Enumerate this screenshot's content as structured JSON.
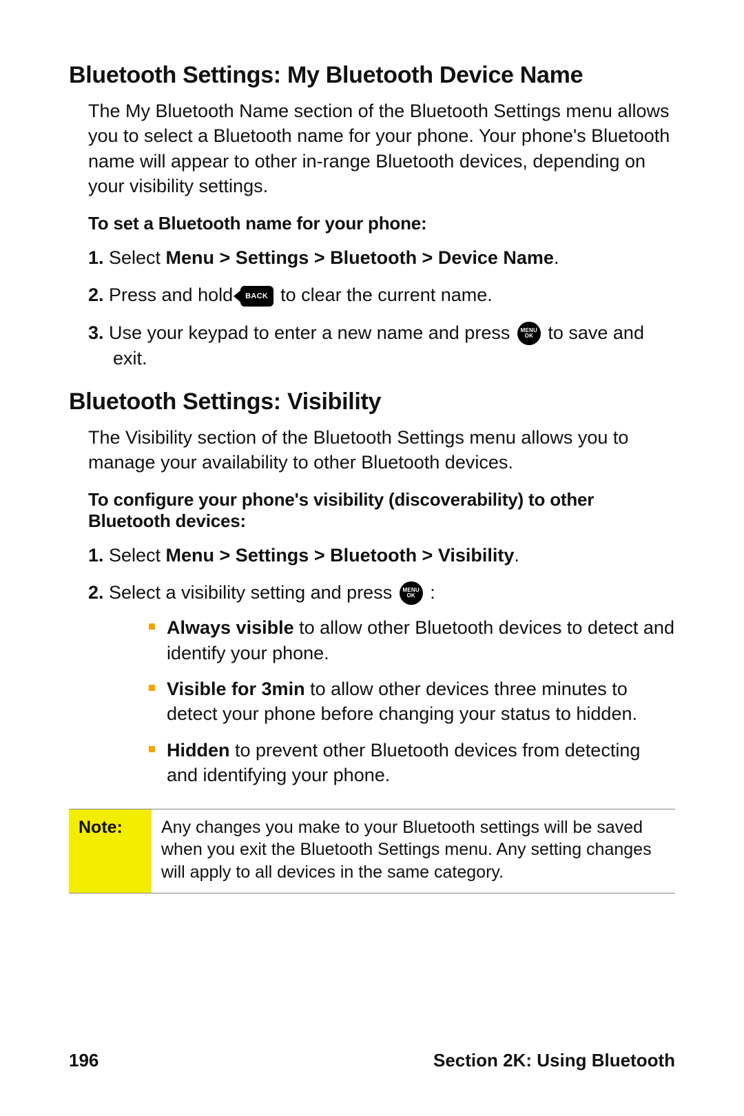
{
  "section1": {
    "heading": "Bluetooth Settings: My Bluetooth Device Name",
    "intro": "The My Bluetooth Name section of the Bluetooth Settings menu allows you to select a Bluetooth name for your phone. Your phone's Bluetooth name will appear to other in-range Bluetooth devices, depending on your visibility settings.",
    "lead": "To set a Bluetooth name for your phone:",
    "steps": {
      "s1": {
        "num": "1.",
        "pre": "Select ",
        "bold": "Menu > Settings > Bluetooth > Device Name",
        "post": "."
      },
      "s2": {
        "num": "2.",
        "pre": "Press and hold ",
        "post": " to clear the current name."
      },
      "s3": {
        "num": "3.",
        "pre": "Use your keypad to enter a new name and press ",
        "post": " to save and exit."
      }
    }
  },
  "section2": {
    "heading": "Bluetooth Settings: Visibility",
    "intro": "The Visibility section of the Bluetooth Settings menu allows you to manage your availability to other Bluetooth devices.",
    "lead": "To configure your phone's visibility (discoverability) to other Bluetooth devices:",
    "steps": {
      "s1": {
        "num": "1.",
        "pre": "Select ",
        "bold": "Menu > Settings > Bluetooth > Visibility",
        "post": "."
      },
      "s2": {
        "num": "2.",
        "pre": "Select a visibility setting and press ",
        "post": " :"
      }
    },
    "bullets": {
      "b1": {
        "bold": "Always visible",
        "rest": " to allow other Bluetooth devices to detect and identify your phone."
      },
      "b2": {
        "bold": "Visible for 3min",
        "rest": " to allow other devices three minutes to detect your phone before changing your status to hidden."
      },
      "b3": {
        "bold": "Hidden",
        "rest": " to prevent other Bluetooth devices from detecting and identifying your phone."
      }
    }
  },
  "note": {
    "label": "Note:",
    "text": "Any changes you make to your Bluetooth settings will be saved when you exit the Bluetooth Settings menu. Any setting changes will apply to all devices in the same category."
  },
  "icons": {
    "back": "BACK",
    "menu_top": "MENU",
    "menu_bottom": "OK"
  },
  "footer": {
    "page": "196",
    "section": "Section 2K: Using Bluetooth"
  }
}
